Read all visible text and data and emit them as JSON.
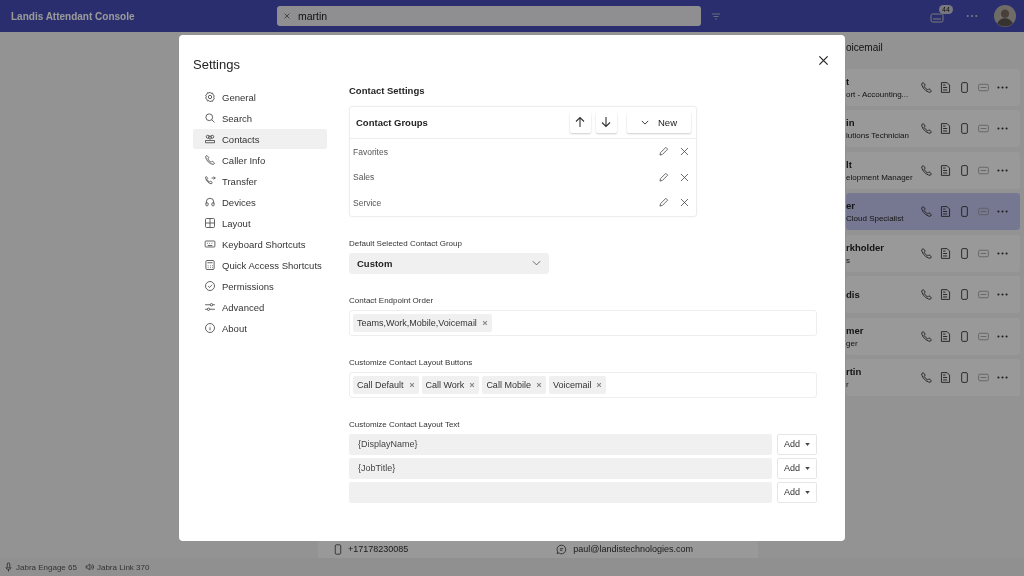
{
  "header": {
    "title": "Landis Attendant Console",
    "search": {
      "value": "martin"
    },
    "badge": "44"
  },
  "contacts_panel": {
    "header": "oicemail",
    "rows": [
      {
        "name": "t",
        "subtitle": "ort - Accounting...",
        "selected": false
      },
      {
        "name": "in",
        "subtitle": "lutions Technician",
        "selected": false
      },
      {
        "name": "lt",
        "subtitle": "elopment Manager",
        "selected": false
      },
      {
        "name": "er",
        "subtitle": "Cloud Specialist",
        "selected": true
      },
      {
        "name": "rkholder",
        "subtitle": "s",
        "selected": false
      },
      {
        "name": "dis",
        "selected": false
      },
      {
        "name": "mer",
        "subtitle": "ger",
        "selected": false
      },
      {
        "name": "rtin",
        "subtitle": "r",
        "selected": false
      }
    ]
  },
  "detail_strip": {
    "phone": "+17178230085",
    "email": "paul@landistechnologies.com"
  },
  "status_bar": {
    "devices": [
      {
        "kind": "microphone",
        "label": "Jabra Engage 65"
      },
      {
        "kind": "speaker",
        "label": "Jabra Link 370"
      }
    ]
  },
  "settings": {
    "title": "Settings",
    "nav": [
      {
        "label": "General",
        "selected": false
      },
      {
        "label": "Search",
        "selected": false
      },
      {
        "label": "Contacts",
        "selected": true
      },
      {
        "label": "Caller Info",
        "selected": false
      },
      {
        "label": "Transfer",
        "selected": false
      },
      {
        "label": "Devices",
        "selected": false
      },
      {
        "label": "Layout",
        "selected": false
      },
      {
        "label": "Keyboard Shortcuts",
        "selected": false
      },
      {
        "label": "Quick Access Shortcuts",
        "selected": false
      },
      {
        "label": "Permissions",
        "selected": false
      },
      {
        "label": "Advanced",
        "selected": false
      },
      {
        "label": "About",
        "selected": false
      }
    ],
    "section_title": "Contact Settings",
    "contact_groups": {
      "title": "Contact Groups",
      "new_button": "New",
      "items": [
        "Favorites",
        "Sales",
        "Service"
      ]
    },
    "default_group": {
      "label": "Default Selected Contact Group",
      "value": "Custom"
    },
    "endpoint_order": {
      "label": "Contact Endpoint Order",
      "tags": [
        "Teams,Work,Mobile,Voicemail"
      ]
    },
    "layout_buttons": {
      "label": "Customize Contact Layout Buttons",
      "tags": [
        "Call Default",
        "Call Work",
        "Call Mobile",
        "Voicemail"
      ]
    },
    "layout_text": {
      "label": "Customize Contact Layout Text",
      "rows": [
        {
          "value": "{DisplayName}",
          "add": "Add"
        },
        {
          "value": "{JobTitle}",
          "add": "Add"
        },
        {
          "add": "Add"
        }
      ]
    }
  }
}
